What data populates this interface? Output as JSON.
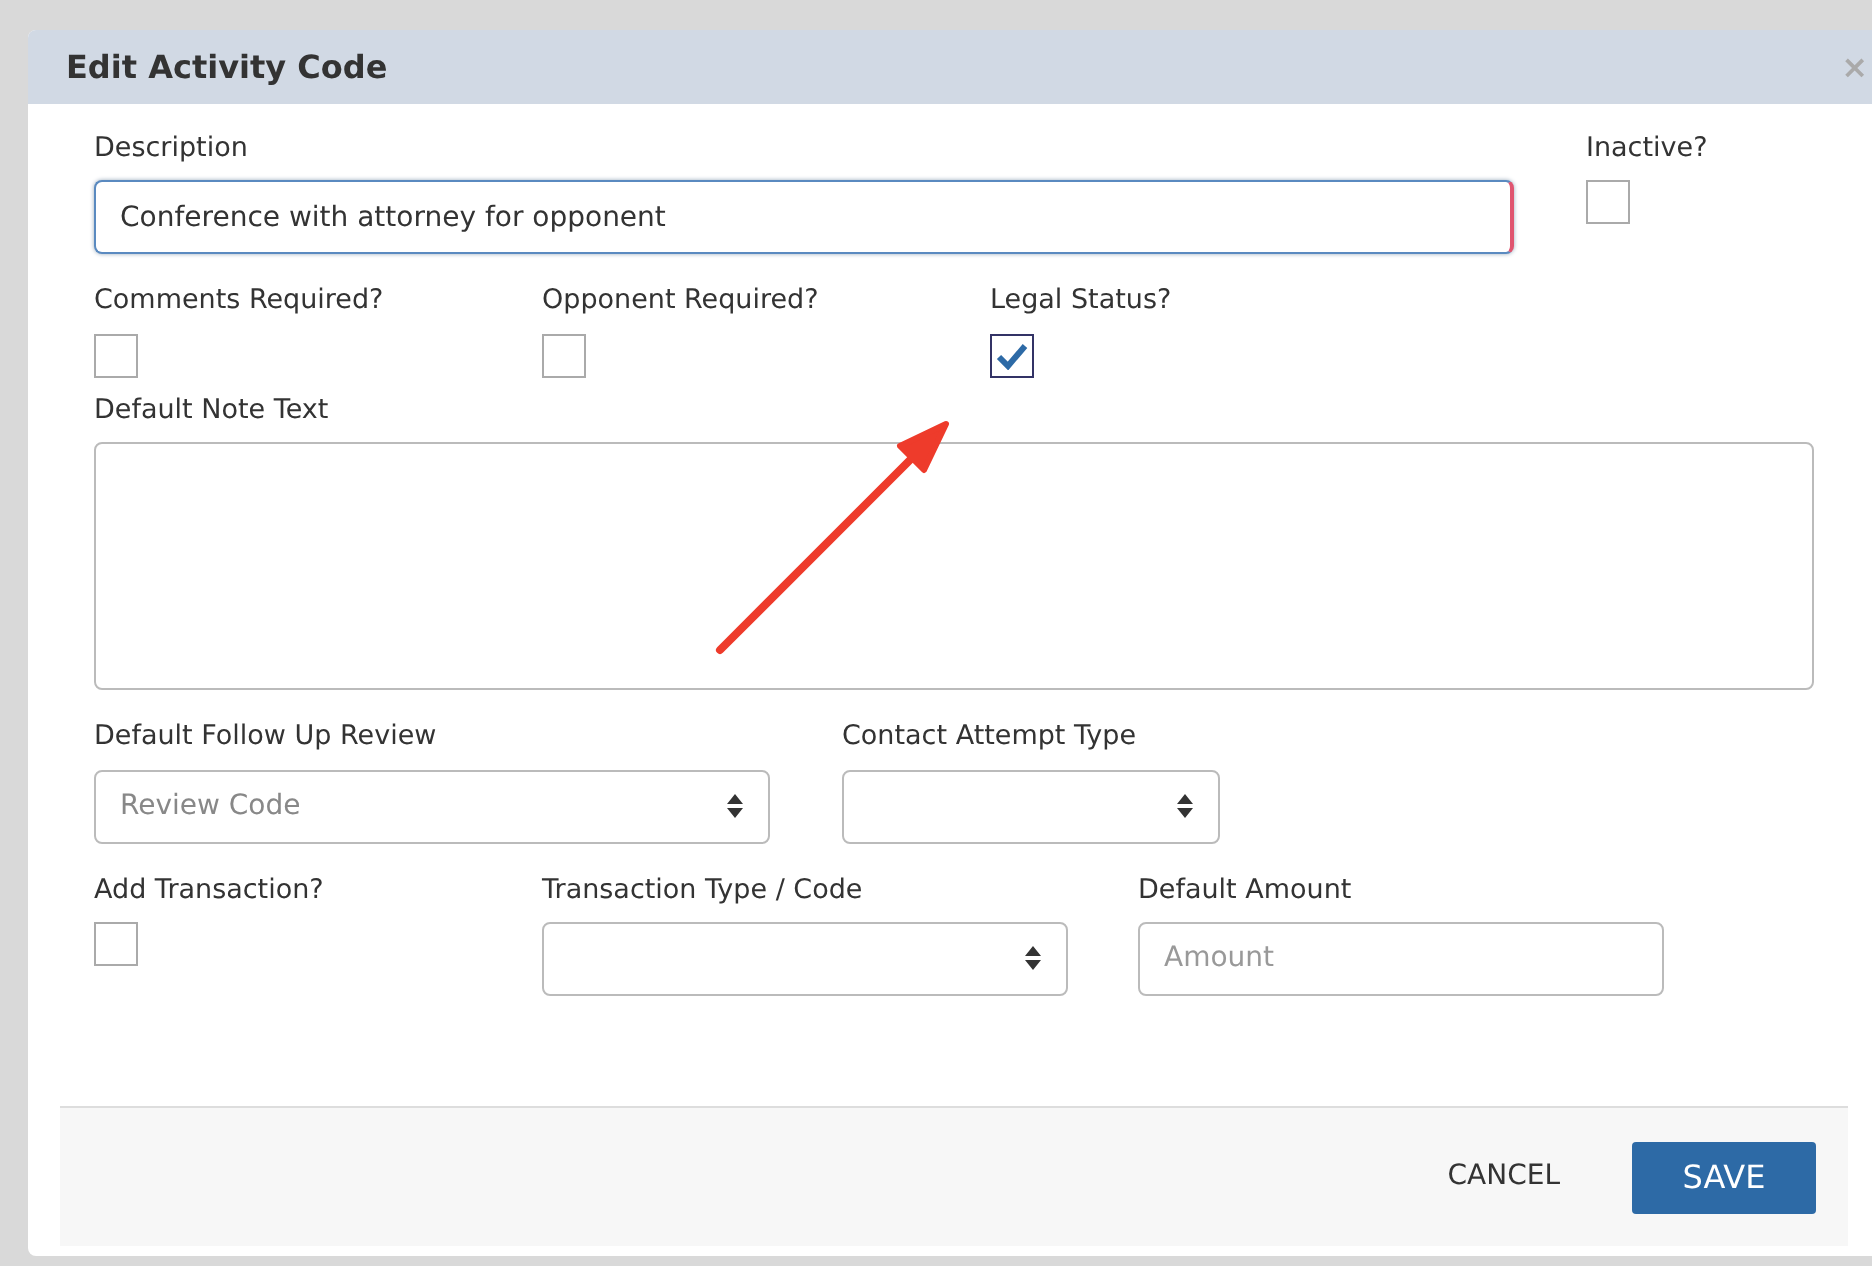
{
  "dialog": {
    "title": "Edit Activity Code",
    "close": "×"
  },
  "description": {
    "label": "Description",
    "value": "Conference with attorney for opponent"
  },
  "inactive": {
    "label": "Inactive?",
    "checked": false
  },
  "flags": [
    {
      "label": "Comments Required?",
      "checked": false
    },
    {
      "label": "Opponent Required?",
      "checked": false
    },
    {
      "label": "Legal Status?",
      "checked": true
    }
  ],
  "note": {
    "label": "Default Note Text"
  },
  "follow_up": {
    "label": "Default Follow Up Review",
    "placeholder": "Review Code"
  },
  "contact": {
    "label": "Contact Attempt Type"
  },
  "add_transaction": {
    "label": "Add Transaction?",
    "checked": false
  },
  "transaction_type": {
    "label": "Transaction Type / Code"
  },
  "amount": {
    "label": "Default Amount",
    "placeholder": "Amount"
  },
  "buttons": [
    {
      "kind": "link",
      "label": "CANCEL"
    },
    {
      "kind": "primary",
      "label": "SAVE"
    }
  ]
}
